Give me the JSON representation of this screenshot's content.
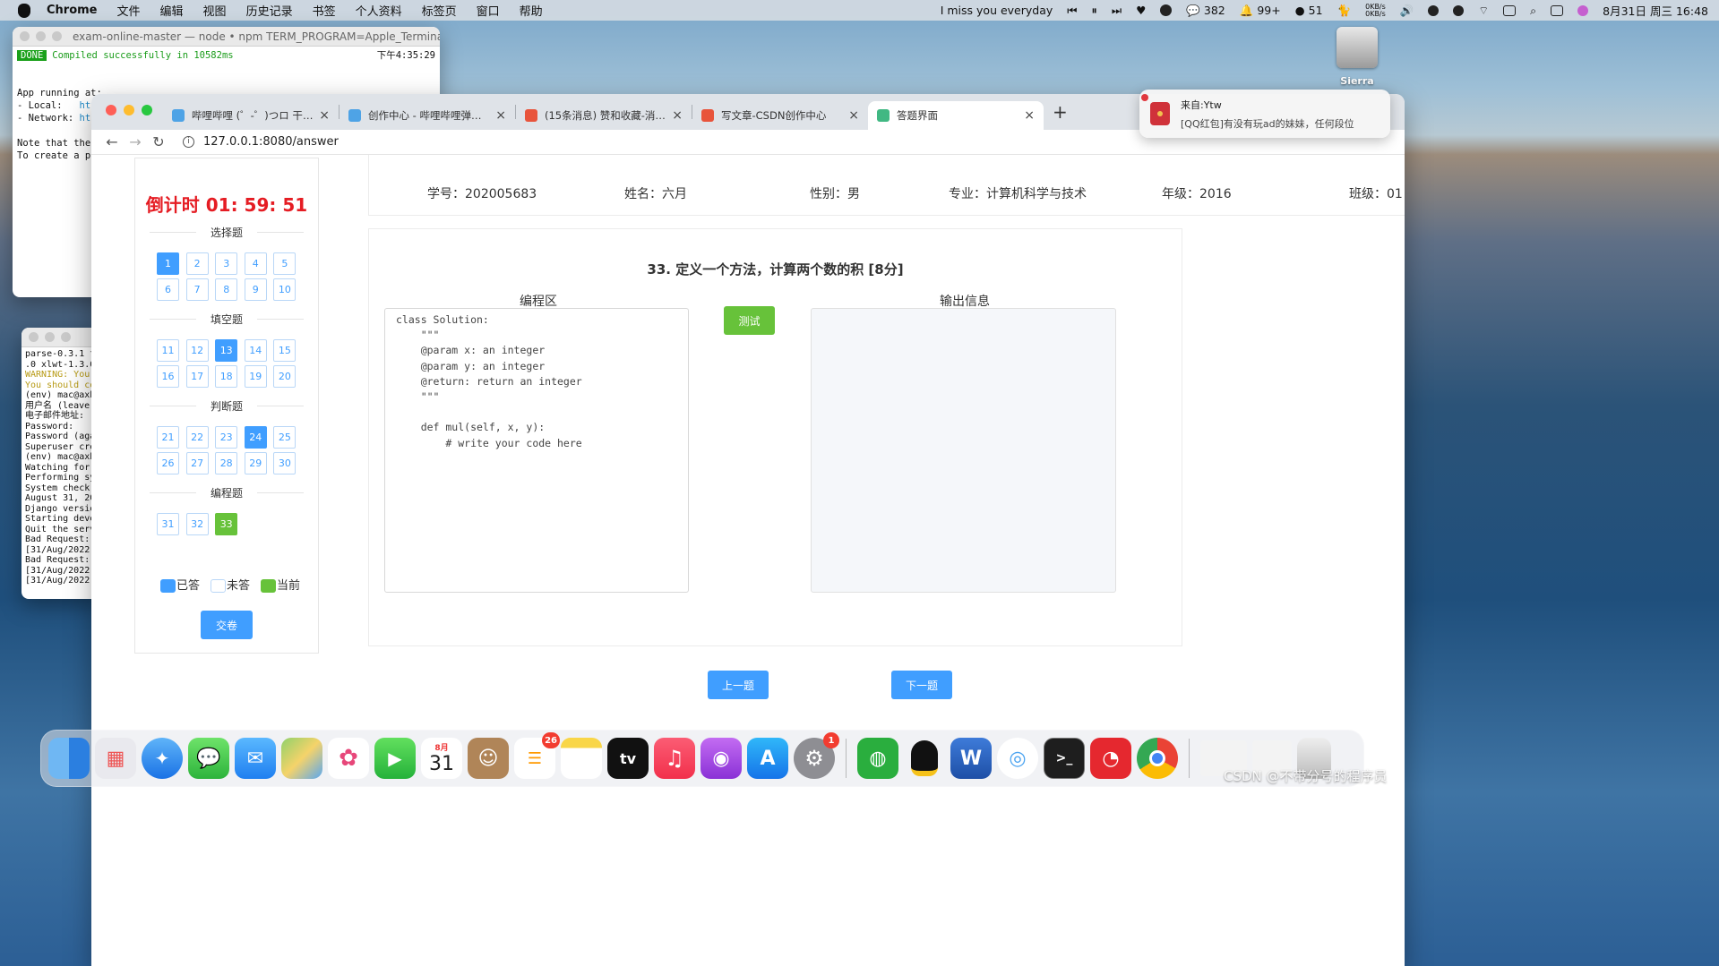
{
  "menubar": {
    "app": "Chrome",
    "items": [
      "文件",
      "编辑",
      "视图",
      "历史记录",
      "书签",
      "个人资料",
      "标签页",
      "窗口",
      "帮助"
    ],
    "now_playing": "I miss you everyday",
    "stat_qq": "382",
    "stat_bell": "99+",
    "stat_wechat": "51",
    "net_up": "0KB/s",
    "net_down": "0KB/s",
    "datetime": "8月31日 周三  16:48"
  },
  "desktop": {
    "disk_label": "Sierra"
  },
  "terminal1": {
    "title": "exam-online-master — node • npm TERM_PROGRAM=Apple_Terminal SHEL...",
    "done": "DONE",
    "compiled": "Compiled successfully in 10582ms",
    "time": "下午4:35:29",
    "l1": "App running at:",
    "l2a": "- Local:   ",
    "l2b": "htt",
    "l3a": "- Network: ",
    "l3b": "ht",
    "l4": "Note that the",
    "l5": "To create a p"
  },
  "terminal2": {
    "lines": [
      "parse-0.3.1 t",
      ".0 xlwt-1.3.0"
    ],
    "warn1": "WARNING: You",
    "warn2": "You should co",
    "lines2": [
      "(env) mac@axb",
      "用户名 (leave",
      "电子邮件地址:",
      "Password:",
      "Password (aga",
      "Superuser cre",
      "(env) mac@axb",
      "Watching for",
      "Performing sy",
      "",
      "System check",
      "August 31, 20",
      "Django versio",
      "Starting deve",
      "Quit the serv",
      "Bad Request:",
      "[31/Aug/2022",
      "Bad Request:",
      "[31/Aug/2022",
      "[31/Aug/2022"
    ]
  },
  "browser": {
    "tabs": [
      {
        "title": "哔哩哔哩 (゜-゜)つロ 干杯~-bili",
        "color": "#4ea3e6"
      },
      {
        "title": "创作中心 - 哔哩哔哩弹幕视频网",
        "color": "#4ea3e6"
      },
      {
        "title": "(15条消息) 赞和收藏-消息-CSDN",
        "color": "#e8543b"
      },
      {
        "title": "写文章-CSDN创作中心",
        "color": "#e8543b"
      },
      {
        "title": "答题界面",
        "color": "#41b883"
      }
    ],
    "url": "127.0.0.1:8080/answer"
  },
  "notification": {
    "from": "来自:Ytw",
    "msg": "[QQ红包]有没有玩ad的妹妹，任何段位"
  },
  "exam": {
    "countdown": "倒计时 01: 59: 51",
    "sections": [
      {
        "name": "选择题",
        "nums": [
          "1",
          "2",
          "3",
          "4",
          "5",
          "6",
          "7",
          "8",
          "9",
          "10"
        ],
        "state": [
          "ans",
          "",
          "",
          "",
          "",
          "",
          "",
          "",
          "",
          ""
        ]
      },
      {
        "name": "填空题",
        "nums": [
          "11",
          "12",
          "13",
          "14",
          "15",
          "16",
          "17",
          "18",
          "19",
          "20"
        ],
        "state": [
          "",
          "",
          "ans",
          "",
          "",
          "",
          "",
          "",
          "",
          ""
        ]
      },
      {
        "name": "判断题",
        "nums": [
          "21",
          "22",
          "23",
          "24",
          "25",
          "26",
          "27",
          "28",
          "29",
          "30"
        ],
        "state": [
          "",
          "",
          "",
          "ans",
          "",
          "",
          "",
          "",
          "",
          ""
        ]
      },
      {
        "name": "编程题",
        "nums": [
          "31",
          "32",
          "33"
        ],
        "state": [
          "",
          "",
          "cur"
        ]
      }
    ],
    "legend": {
      "answered": "已答",
      "unanswered": "未答",
      "current": "当前",
      "answered_color": "#409eff",
      "current_color": "#67c23a"
    },
    "submit": "交卷",
    "student": {
      "id": "学号：202005683",
      "name": "姓名：六月",
      "gender": "性别：男",
      "major": "专业：计算机科学与技术",
      "grade": "年级：2016",
      "class": "班级：01"
    },
    "question_title": "33. 定义一个方法，计算两个数的积 [8分]",
    "code_label": "编程区",
    "output_label": "输出信息",
    "test_button": "测试",
    "code": "class Solution:\n    \"\"\"\n    @param x: an integer\n    @param y: an integer\n    @return: return an integer\n    \"\"\"\n\n    def mul(self, x, y):\n        # write your code here",
    "prev": "上一题",
    "next": "下一题"
  },
  "dock": {
    "calendar_month": "8月",
    "calendar_day": "31",
    "reminders_badge": "26",
    "settings_badge": "1",
    "tv_label": "tv",
    "watermark": "CSDN @不带分号的程序员"
  }
}
